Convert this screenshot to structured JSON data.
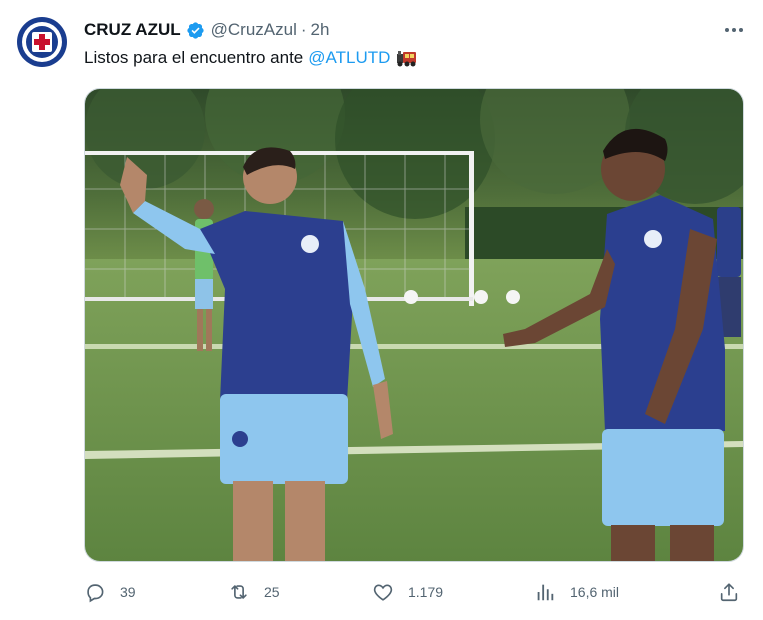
{
  "account": {
    "name": "CRUZ AZUL",
    "handle": "@CruzAzul",
    "separator": "·",
    "time": "2h",
    "avatar_icon": "cruz-azul-crest",
    "verified_icon": "verified-badge",
    "verified_color": "#1d9bf0"
  },
  "tweet": {
    "text": "Listos para el encuentro ante",
    "mention": "@ATLUTD",
    "emoji_icon": "train-icon",
    "media_alt": "Cruz Azul players training on a soccer field"
  },
  "actions": {
    "replies": "39",
    "retweets": "25",
    "likes": "1.179",
    "views": "16,6 mil"
  },
  "colors": {
    "text": "#0f1419",
    "secondary": "#536471",
    "accent": "#1d9bf0"
  }
}
